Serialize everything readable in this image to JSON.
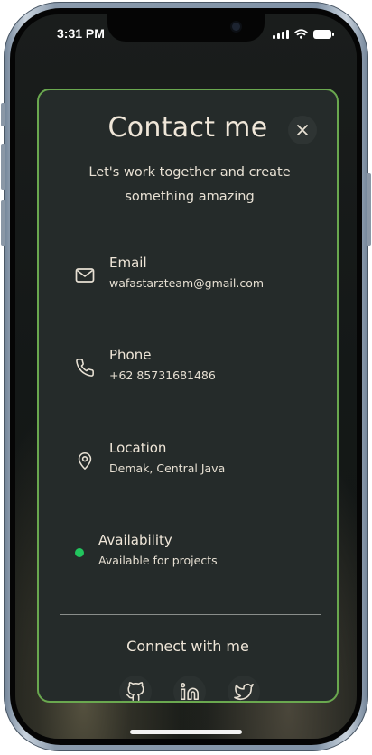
{
  "status_bar": {
    "time": "3:31 PM"
  },
  "contact": {
    "title": "Contact me",
    "subtitle": "Let's work together and create something amazing",
    "items": [
      {
        "label": "Email",
        "value": "wafastarzteam@gmail.com",
        "icon": "mail-icon"
      },
      {
        "label": "Phone",
        "value": "+62 85731681486",
        "icon": "phone-icon"
      },
      {
        "label": "Location",
        "value": "Demak, Central Java",
        "icon": "map-pin-icon"
      },
      {
        "label": "Availability",
        "value": "Available for projects",
        "icon": "status-dot",
        "status_color": "#22c55e"
      }
    ],
    "connect_label": "Connect with me",
    "social": [
      "github-icon",
      "linkedin-icon",
      "twitter-icon"
    ]
  },
  "colors": {
    "accent_border": "#6aa84f",
    "modal_bg": "#252b2a",
    "text": "#efe6d8"
  }
}
